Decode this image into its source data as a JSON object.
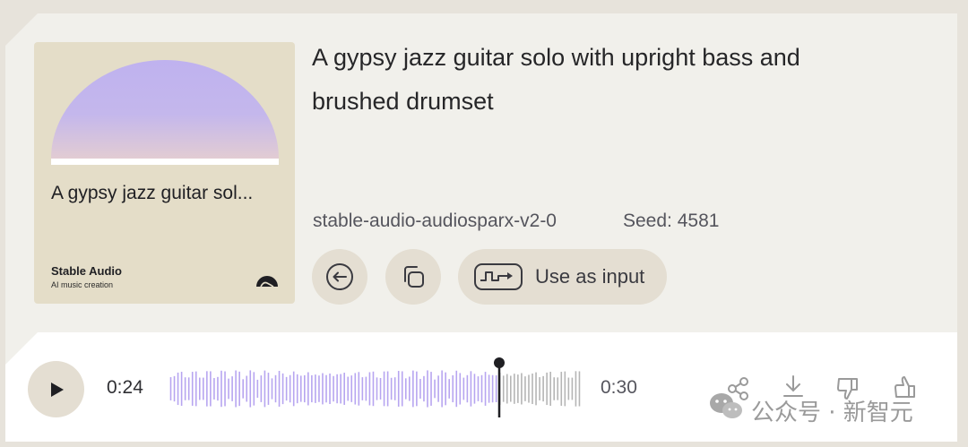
{
  "cover": {
    "title": "A gypsy jazz guitar sol...",
    "brand": "Stable Audio",
    "tagline": "AI music creation",
    "gradient_top": "#bfb2ef",
    "gradient_bottom": "#e2ccd3"
  },
  "track": {
    "prompt": "A gypsy jazz guitar solo with upright bass and brushed drumset",
    "model": "stable-audio-audiosparx-v2-0",
    "seed": "Seed: 4581"
  },
  "actions": {
    "reuse_icon": "arrow-left-circle-icon",
    "copy_icon": "copy-icon",
    "use_as_input_label": "Use as input",
    "use_as_input_icon": "waveform-arrow-icon"
  },
  "player": {
    "current_time": "0:24",
    "total_time": "0:30",
    "progress": 0.8,
    "played_color": "#b7a5f0",
    "unplayed_color": "#b5b5b5",
    "play_icon": "play-icon"
  },
  "watermark": {
    "text": "公众号 · 新智元"
  },
  "colors": {
    "card_bg": "#f1f0eb",
    "button_bg": "#e4ded2",
    "page_bg": "#e7e3db"
  }
}
